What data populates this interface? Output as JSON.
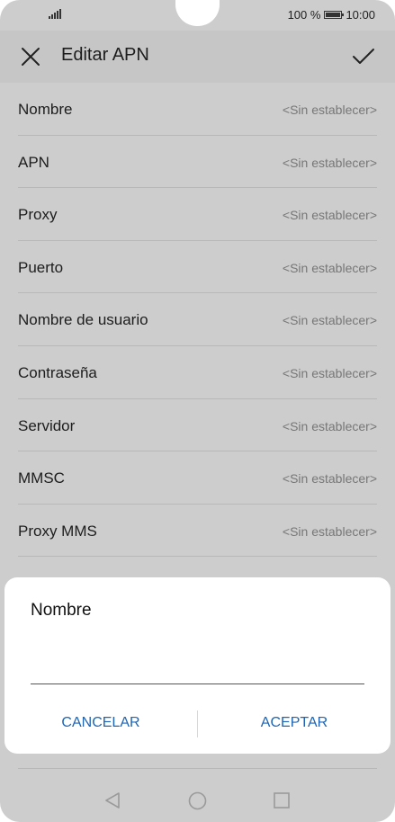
{
  "status_bar": {
    "battery_text": "100 %",
    "time": "10:00"
  },
  "app_bar": {
    "title": "Editar APN"
  },
  "fields": [
    {
      "label": "Nombre",
      "value": "<Sin establecer>"
    },
    {
      "label": "APN",
      "value": "<Sin establecer>"
    },
    {
      "label": "Proxy",
      "value": "<Sin establecer>"
    },
    {
      "label": "Puerto",
      "value": "<Sin establecer>"
    },
    {
      "label": "Nombre de usuario",
      "value": "<Sin establecer>"
    },
    {
      "label": "Contraseña",
      "value": "<Sin establecer>"
    },
    {
      "label": "Servidor",
      "value": "<Sin establecer>"
    },
    {
      "label": "MMSC",
      "value": "<Sin establecer>"
    },
    {
      "label": "Proxy MMS",
      "value": "<Sin establecer>"
    }
  ],
  "dialog": {
    "title": "Nombre",
    "input_value": "",
    "cancel_label": "CANCELAR",
    "accept_label": "ACEPTAR"
  },
  "icons": {
    "close": "close-icon",
    "confirm": "check-icon",
    "back": "nav-back-icon",
    "home": "nav-home-icon",
    "recent": "nav-recent-icon"
  },
  "colors": {
    "accent": "#1e65b5",
    "dim_background": "#cdcdcd"
  }
}
